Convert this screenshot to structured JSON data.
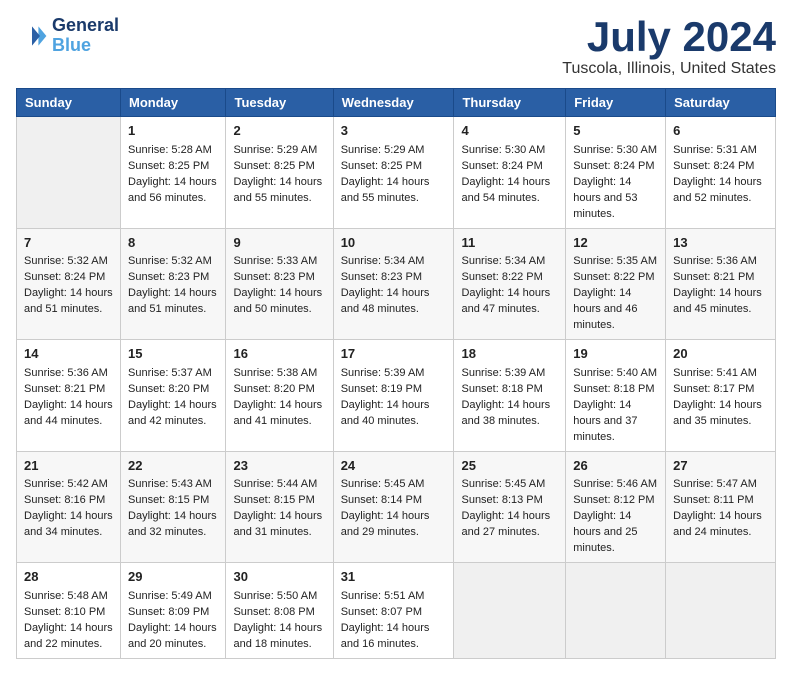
{
  "logo": {
    "line1": "General",
    "line2": "Blue"
  },
  "title": "July 2024",
  "subtitle": "Tuscola, Illinois, United States",
  "days_header": [
    "Sunday",
    "Monday",
    "Tuesday",
    "Wednesday",
    "Thursday",
    "Friday",
    "Saturday"
  ],
  "weeks": [
    [
      {
        "day": "",
        "sunrise": "",
        "sunset": "",
        "daylight": ""
      },
      {
        "day": "1",
        "sunrise": "Sunrise: 5:28 AM",
        "sunset": "Sunset: 8:25 PM",
        "daylight": "Daylight: 14 hours and 56 minutes."
      },
      {
        "day": "2",
        "sunrise": "Sunrise: 5:29 AM",
        "sunset": "Sunset: 8:25 PM",
        "daylight": "Daylight: 14 hours and 55 minutes."
      },
      {
        "day": "3",
        "sunrise": "Sunrise: 5:29 AM",
        "sunset": "Sunset: 8:25 PM",
        "daylight": "Daylight: 14 hours and 55 minutes."
      },
      {
        "day": "4",
        "sunrise": "Sunrise: 5:30 AM",
        "sunset": "Sunset: 8:24 PM",
        "daylight": "Daylight: 14 hours and 54 minutes."
      },
      {
        "day": "5",
        "sunrise": "Sunrise: 5:30 AM",
        "sunset": "Sunset: 8:24 PM",
        "daylight": "Daylight: 14 hours and 53 minutes."
      },
      {
        "day": "6",
        "sunrise": "Sunrise: 5:31 AM",
        "sunset": "Sunset: 8:24 PM",
        "daylight": "Daylight: 14 hours and 52 minutes."
      }
    ],
    [
      {
        "day": "7",
        "sunrise": "Sunrise: 5:32 AM",
        "sunset": "Sunset: 8:24 PM",
        "daylight": "Daylight: 14 hours and 51 minutes."
      },
      {
        "day": "8",
        "sunrise": "Sunrise: 5:32 AM",
        "sunset": "Sunset: 8:23 PM",
        "daylight": "Daylight: 14 hours and 51 minutes."
      },
      {
        "day": "9",
        "sunrise": "Sunrise: 5:33 AM",
        "sunset": "Sunset: 8:23 PM",
        "daylight": "Daylight: 14 hours and 50 minutes."
      },
      {
        "day": "10",
        "sunrise": "Sunrise: 5:34 AM",
        "sunset": "Sunset: 8:23 PM",
        "daylight": "Daylight: 14 hours and 48 minutes."
      },
      {
        "day": "11",
        "sunrise": "Sunrise: 5:34 AM",
        "sunset": "Sunset: 8:22 PM",
        "daylight": "Daylight: 14 hours and 47 minutes."
      },
      {
        "day": "12",
        "sunrise": "Sunrise: 5:35 AM",
        "sunset": "Sunset: 8:22 PM",
        "daylight": "Daylight: 14 hours and 46 minutes."
      },
      {
        "day": "13",
        "sunrise": "Sunrise: 5:36 AM",
        "sunset": "Sunset: 8:21 PM",
        "daylight": "Daylight: 14 hours and 45 minutes."
      }
    ],
    [
      {
        "day": "14",
        "sunrise": "Sunrise: 5:36 AM",
        "sunset": "Sunset: 8:21 PM",
        "daylight": "Daylight: 14 hours and 44 minutes."
      },
      {
        "day": "15",
        "sunrise": "Sunrise: 5:37 AM",
        "sunset": "Sunset: 8:20 PM",
        "daylight": "Daylight: 14 hours and 42 minutes."
      },
      {
        "day": "16",
        "sunrise": "Sunrise: 5:38 AM",
        "sunset": "Sunset: 8:20 PM",
        "daylight": "Daylight: 14 hours and 41 minutes."
      },
      {
        "day": "17",
        "sunrise": "Sunrise: 5:39 AM",
        "sunset": "Sunset: 8:19 PM",
        "daylight": "Daylight: 14 hours and 40 minutes."
      },
      {
        "day": "18",
        "sunrise": "Sunrise: 5:39 AM",
        "sunset": "Sunset: 8:18 PM",
        "daylight": "Daylight: 14 hours and 38 minutes."
      },
      {
        "day": "19",
        "sunrise": "Sunrise: 5:40 AM",
        "sunset": "Sunset: 8:18 PM",
        "daylight": "Daylight: 14 hours and 37 minutes."
      },
      {
        "day": "20",
        "sunrise": "Sunrise: 5:41 AM",
        "sunset": "Sunset: 8:17 PM",
        "daylight": "Daylight: 14 hours and 35 minutes."
      }
    ],
    [
      {
        "day": "21",
        "sunrise": "Sunrise: 5:42 AM",
        "sunset": "Sunset: 8:16 PM",
        "daylight": "Daylight: 14 hours and 34 minutes."
      },
      {
        "day": "22",
        "sunrise": "Sunrise: 5:43 AM",
        "sunset": "Sunset: 8:15 PM",
        "daylight": "Daylight: 14 hours and 32 minutes."
      },
      {
        "day": "23",
        "sunrise": "Sunrise: 5:44 AM",
        "sunset": "Sunset: 8:15 PM",
        "daylight": "Daylight: 14 hours and 31 minutes."
      },
      {
        "day": "24",
        "sunrise": "Sunrise: 5:45 AM",
        "sunset": "Sunset: 8:14 PM",
        "daylight": "Daylight: 14 hours and 29 minutes."
      },
      {
        "day": "25",
        "sunrise": "Sunrise: 5:45 AM",
        "sunset": "Sunset: 8:13 PM",
        "daylight": "Daylight: 14 hours and 27 minutes."
      },
      {
        "day": "26",
        "sunrise": "Sunrise: 5:46 AM",
        "sunset": "Sunset: 8:12 PM",
        "daylight": "Daylight: 14 hours and 25 minutes."
      },
      {
        "day": "27",
        "sunrise": "Sunrise: 5:47 AM",
        "sunset": "Sunset: 8:11 PM",
        "daylight": "Daylight: 14 hours and 24 minutes."
      }
    ],
    [
      {
        "day": "28",
        "sunrise": "Sunrise: 5:48 AM",
        "sunset": "Sunset: 8:10 PM",
        "daylight": "Daylight: 14 hours and 22 minutes."
      },
      {
        "day": "29",
        "sunrise": "Sunrise: 5:49 AM",
        "sunset": "Sunset: 8:09 PM",
        "daylight": "Daylight: 14 hours and 20 minutes."
      },
      {
        "day": "30",
        "sunrise": "Sunrise: 5:50 AM",
        "sunset": "Sunset: 8:08 PM",
        "daylight": "Daylight: 14 hours and 18 minutes."
      },
      {
        "day": "31",
        "sunrise": "Sunrise: 5:51 AM",
        "sunset": "Sunset: 8:07 PM",
        "daylight": "Daylight: 14 hours and 16 minutes."
      },
      {
        "day": "",
        "sunrise": "",
        "sunset": "",
        "daylight": ""
      },
      {
        "day": "",
        "sunrise": "",
        "sunset": "",
        "daylight": ""
      },
      {
        "day": "",
        "sunrise": "",
        "sunset": "",
        "daylight": ""
      }
    ]
  ]
}
